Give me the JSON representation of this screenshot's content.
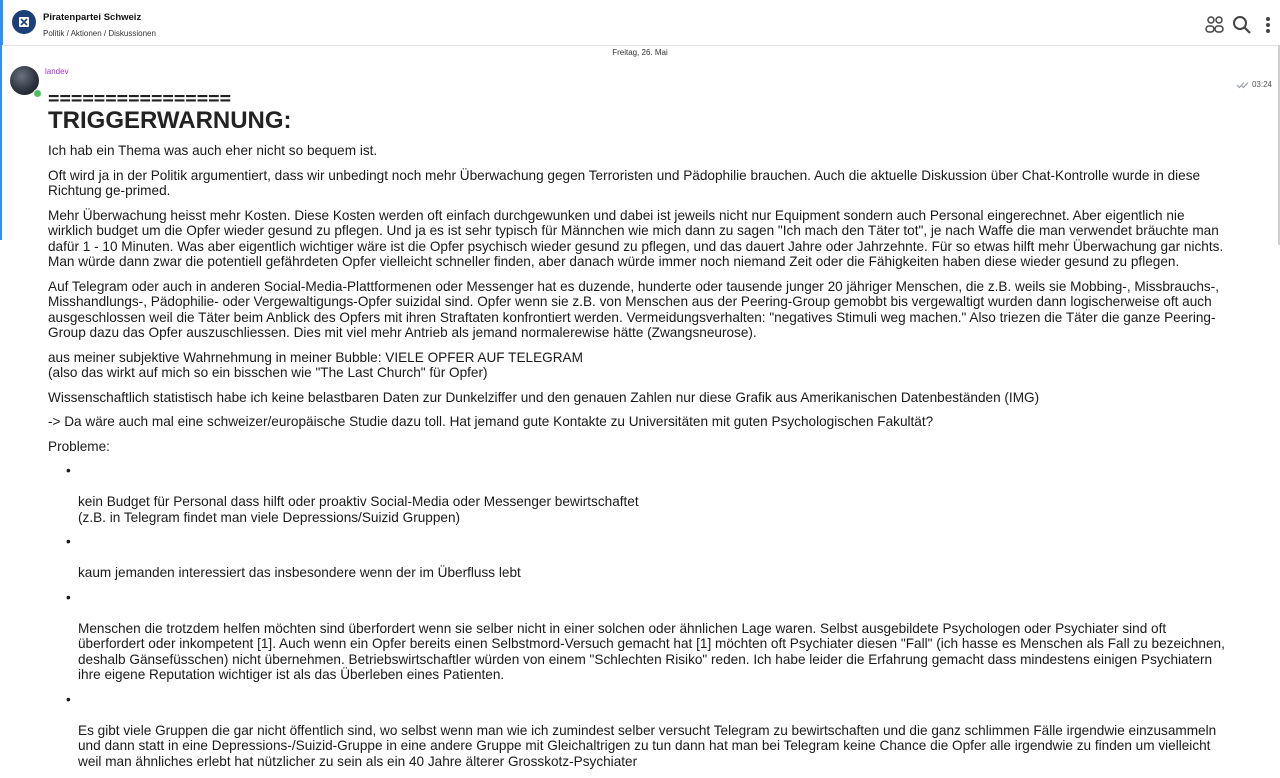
{
  "header": {
    "title": "Piratenpartei Schweiz",
    "breadcrumb": "Politik / Aktionen / Diskussionen",
    "icons": [
      "members-icon",
      "search-icon",
      "more-icon"
    ]
  },
  "date_separator": "Freitag, 26. Mai",
  "message": {
    "author": "landev",
    "time": "03:24",
    "equals_line": "================",
    "heading": "TRIGGERWARNUNG:",
    "paragraphs": [
      "Ich hab ein Thema was auch eher nicht so bequem ist.",
      "Oft wird ja in der Politik argumentiert, dass wir unbedingt noch mehr Überwachung gegen Terroristen und Pädophilie brauchen. Auch die aktuelle Diskussion über Chat-Kontrolle wurde in diese Richtung ge-primed.",
      "Mehr Überwachung heisst mehr Kosten. Diese Kosten werden oft einfach durchgewunken und dabei ist jeweils nicht nur Equipment sondern auch Personal eingerechnet. Aber eigentlich nie wirklich budget um die Opfer wieder gesund zu pflegen. Und ja es ist sehr typisch für Männchen wie mich dann zu sagen \"Ich mach den Täter tot\", je nach Waffe die man verwendet bräuchte man dafür 1 - 10 Minuten. Was aber eigentlich wichtiger wäre ist die Opfer psychisch wieder gesund zu pflegen, und das dauert Jahre oder Jahrzehnte. Für so etwas hilft mehr Überwachung gar nichts. Man würde dann zwar die potentiell gefährdeten Opfer vielleicht schneller finden, aber danach würde immer noch niemand Zeit oder die Fähigkeiten haben diese wieder gesund zu pflegen.",
      "Auf Telegram oder auch in anderen Social-Media-Plattformenen oder Messenger hat es duzende, hunderte oder tausende junger 20 jähriger Menschen, die z.B. weils sie Mobbing-, Missbrauchs-, Misshandlungs-, Pädophilie- oder Vergewaltigungs-Opfer suizidal sind. Opfer wenn sie z.B. von Menschen aus der Peering-Group gemobbt bis vergewaltigt wurden dann logischerweise oft auch ausgeschlossen weil die Täter beim Anblick des Opfers mit ihren Straftaten konfrontiert werden. Vermeidungsverhalten: \"negatives Stimuli weg machen.\" Also triezen die Täter die ganze Peering-Group dazu das Opfer auszuschliessen. Dies mit viel mehr Antrieb als jemand normalerewise hätte (Zwangsneurose).",
      "aus meiner subjektive Wahrnehmung in meiner Bubble: VIELE OPFER AUF TELEGRAM\n(also das wirkt auf mich so ein bisschen wie \"The Last Church\" für Opfer)",
      "Wissenschaftlich statistisch habe ich keine belastbaren Daten zur Dunkelziffer und den genauen Zahlen nur diese Grafik aus Amerikanischen Datenbeständen (IMG)",
      "-> Da wäre auch mal eine schweizer/europäische Studie dazu toll. Hat jemand gute Kontakte zu Universitäten mit guten Psychologischen Fakultät?",
      "Probleme:"
    ],
    "bullets": [
      "kein Budget für Personal dass hilft oder proaktiv Social-Media oder Messenger bewirtschaftet\n(z.B. in Telegram findet man viele Depressions/Suizid Gruppen)",
      "kaum jemanden interessiert das insbesondere wenn der im Überfluss lebt",
      "Menschen die trotzdem helfen möchten sind überfordert wenn sie selber nicht in einer solchen oder ähnlichen Lage waren. Selbst ausgebildete Psychologen oder Psychiater sind oft überfordert oder inkompetent [1]. Auch wenn ein Opfer bereits einen Selbstmord-Versuch gemacht hat [1] möchten oft Psychiater diesen \"Fall\" (ich hasse es Menschen als Fall zu bezeichnen, deshalb Gänsefüsschen) nicht übernehmen. Betriebswirtschaftler würden von einem \"Schlechten Risiko\" reden. Ich habe leider die Erfahrung gemacht dass mindestens einigen Psychiatern ihre eigene Reputation wichtiger ist als das Überleben eines Patienten.",
      "Es gibt viele Gruppen die gar nicht öffentlich sind, wo selbst wenn man wie ich zumindest selber versucht Telegram zu bewirtschaften und die ganz schlimmen Fälle irgendwie einzusammeln und dann statt in eine Depressions-/Suizid-Gruppe in eine andere Gruppe mit Gleichaltrigen zu tun dann hat man bei Telegram keine Chance die Opfer alle irgendwie zu finden um vielleicht weil man ähnliches erlebt hat nützlicher zu sein als ein 40 Jahre älterer Grosskotz-Psychiater"
    ]
  }
}
